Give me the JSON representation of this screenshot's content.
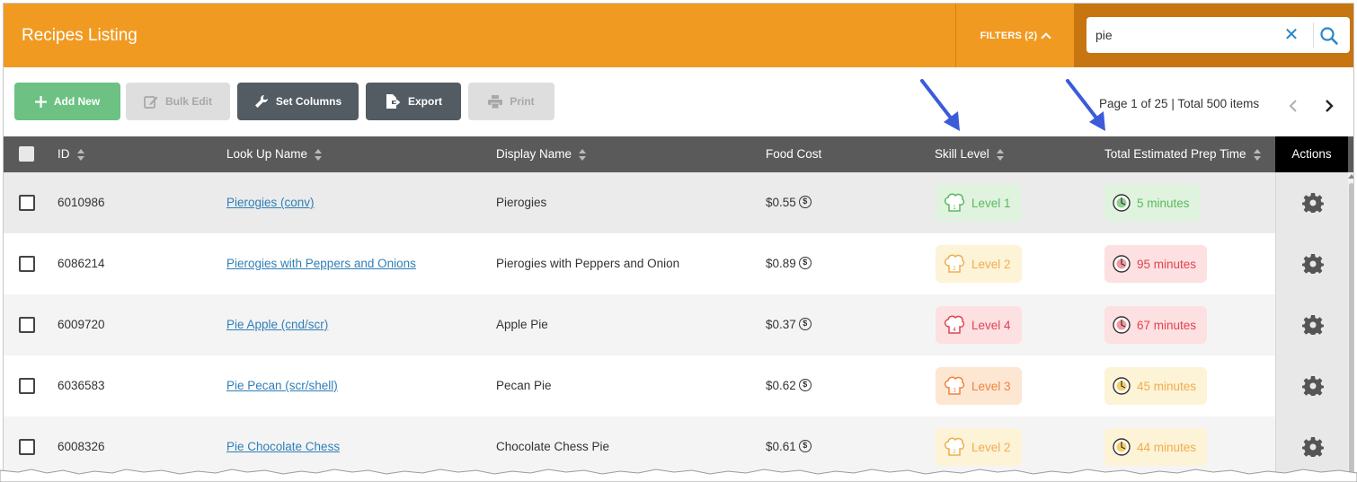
{
  "header": {
    "title": "Recipes Listing",
    "filters_label": "FILTERS (2)",
    "search_value": "pie"
  },
  "toolbar": {
    "add_new": "Add New",
    "bulk_edit": "Bulk Edit",
    "set_columns": "Set Columns",
    "export": "Export",
    "print": "Print",
    "pager_text": "Page 1 of 25 | Total 500 items"
  },
  "table": {
    "columns": {
      "id": "ID",
      "lookup": "Look Up Name",
      "display": "Display Name",
      "food_cost": "Food Cost",
      "skill": "Skill Level",
      "prep": "Total Estimated Prep Time",
      "actions": "Actions"
    },
    "rows": [
      {
        "id": "6010986",
        "lookup": "Pierogies (conv)",
        "display": "Pierogies",
        "cost": "$0.55",
        "skill": "Level 1",
        "prep": "5 minutes"
      },
      {
        "id": "6086214",
        "lookup": "Pierogies with Peppers and Onions",
        "display": "Pierogies with Peppers and Onion",
        "cost": "$0.89",
        "skill": "Level 2",
        "prep": "95 minutes"
      },
      {
        "id": "6009720",
        "lookup": "Pie Apple (cnd/scr)",
        "display": "Apple Pie",
        "cost": "$0.37",
        "skill": "Level 4",
        "prep": "67 minutes"
      },
      {
        "id": "6036583",
        "lookup": "Pie Pecan (scr/shell)",
        "display": "Pecan Pie",
        "cost": "$0.62",
        "skill": "Level 3",
        "prep": "45 minutes"
      },
      {
        "id": "6008326",
        "lookup": "Pie Chocolate Chess",
        "display": "Chocolate Chess Pie",
        "cost": "$0.61",
        "skill": "Level 2",
        "prep": "44 minutes"
      }
    ]
  },
  "icons": {
    "add": "plus-icon",
    "bulk_edit": "edit-icon",
    "set_columns": "wrench-icon",
    "export": "export-icon",
    "print": "printer-icon",
    "skill": "chef-hat-icon",
    "prep": "clock-icon",
    "actions": "gear-icon",
    "search": "search-icon",
    "clear": "close-icon"
  },
  "colors": {
    "header_orange": "#f19a22",
    "search_bg": "#c67510",
    "add_green": "#6cc183",
    "dark_button": "#535b63",
    "level_1": "#5cb85c",
    "level_2": "#f0ad4e",
    "level_3": "#f0843c",
    "level_4": "#e0444e",
    "link": "#2f7fb7",
    "annotation_arrow": "#3b5bdb"
  }
}
